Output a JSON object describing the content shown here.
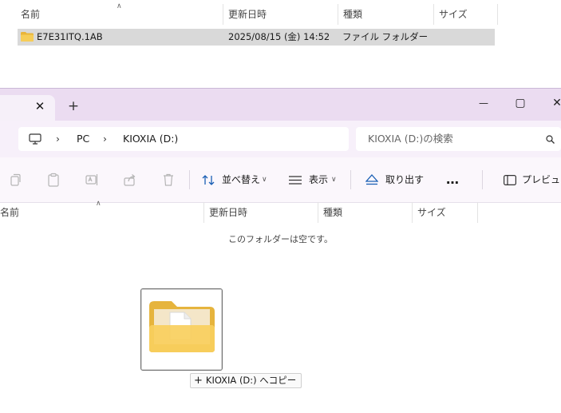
{
  "background_window": {
    "columns": [
      "名前",
      "更新日時",
      "種類",
      "サイズ"
    ],
    "selected_item": {
      "name": "E7E31ITQ.1AB",
      "modified": "2025/08/15 (金) 14:52",
      "type": "ファイル フォルダー",
      "size": ""
    }
  },
  "foreground_window": {
    "tab": {
      "close": "✕",
      "new_tab": "+"
    },
    "window_controls": {
      "minimize": "—",
      "maximize": "▢",
      "close": "✕"
    },
    "breadcrumb": [
      "PC",
      "KIOXIA (D:)"
    ],
    "search_placeholder": "KIOXIA (D:)の検索",
    "toolbar": {
      "sort_label": "並べ替え",
      "view_label": "表示",
      "eject_label": "取り出す",
      "more_label": "…",
      "preview_label": "プレビュー"
    },
    "columns": [
      "名前",
      "更新日時",
      "種類",
      "サイズ"
    ],
    "empty_message": "このフォルダーは空です。",
    "drag": {
      "tooltip": "KIOXIA (D:) へコピー",
      "tooltip_icon": "+"
    }
  },
  "colors": {
    "titlebar": "#ebdcf1",
    "navbar": "#f7f0fa",
    "selection": "#d9d9d9",
    "folder": "#f3c64b"
  },
  "icons": [
    "folder-icon",
    "monitor-icon",
    "chevron-right-icon",
    "search-icon",
    "copy-icon",
    "paste-icon",
    "rename-icon",
    "share-icon",
    "delete-icon",
    "sort-icon",
    "view-icon",
    "eject-icon",
    "more-icon",
    "preview-icon"
  ]
}
